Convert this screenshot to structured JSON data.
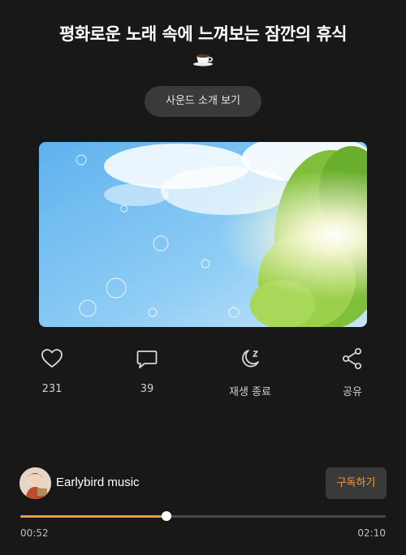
{
  "title": "평화로운 노래 속에 느껴보는 잠깐의 휴식",
  "title_emoji_icon": "coffee-cup-icon",
  "intro_button": "사운드 소개 보기",
  "actions": [
    {
      "icon": "heart-icon",
      "label": "231"
    },
    {
      "icon": "comment-icon",
      "label": "39"
    },
    {
      "icon": "moon-sleep-icon",
      "label": "재생 종료"
    },
    {
      "icon": "share-icon",
      "label": "공유"
    }
  ],
  "channel": {
    "name": "Earlybird music",
    "subscribe_label": "구독하기"
  },
  "player": {
    "current_time": "00:52",
    "total_time": "02:10",
    "progress": 0.4
  },
  "colors": {
    "accent": "#f29c38",
    "background": "#181818",
    "button_bg": "#3a3a3a"
  }
}
